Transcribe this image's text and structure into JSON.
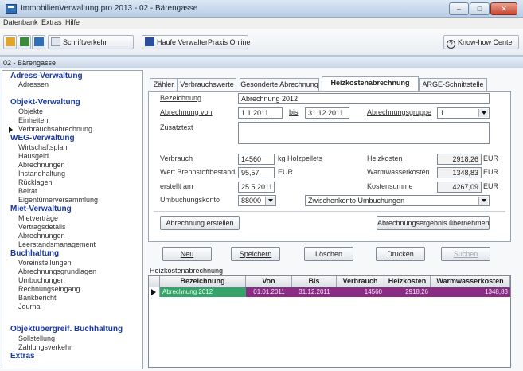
{
  "window": {
    "title": "ImmobilienVerwaltung pro 2013 - 02 - Bärengasse",
    "minimize": "–",
    "maximize": "□",
    "close": "✕"
  },
  "menu": [
    "Datenbank",
    "Extras",
    "Hilfe"
  ],
  "toolbar": {
    "schriftverkehr": "Schriftverkehr",
    "haufe": "Haufe VerwalterPraxis Online",
    "knowhow": "Know-how Center"
  },
  "document_title": "02 - Bärengasse",
  "sidebar": {
    "adress_head": "Adress-Verwaltung",
    "adress_items": [
      "Adressen"
    ],
    "objekt_head": "Objekt-Verwaltung",
    "objekt_items": [
      "Objekte",
      "Einheiten",
      "Verbrauchsabrechnung"
    ],
    "weg_head": "WEG-Verwaltung",
    "weg_items": [
      "Wirtschaftsplan",
      "Hausgeld",
      "Abrechnungen",
      "Instandhaltung",
      "Rücklagen",
      "Beirat",
      "Eigentümerversammlung"
    ],
    "miet_head": "Miet-Verwaltung",
    "miet_items": [
      "Mietverträge",
      "Vertragsdetails",
      "Abrechnungen",
      "Leerstandsmanagement"
    ],
    "buch_head": "Buchhaltung",
    "buch_items": [
      "Voreinstellungen",
      "Abrechnungsgrundlagen",
      "Umbuchungen",
      "Rechnungseingang",
      "Bankbericht",
      "Journal"
    ],
    "obj_buch_head": "Objektübergreif. Buchhaltung",
    "obj_buch_items": [
      "Sollstellung",
      "Zahlungsverkehr"
    ],
    "extras_head": "Extras"
  },
  "tabs": [
    "Zähler",
    "Verbrauchswerte",
    "Gesonderte Abrechnung",
    "Heizkostenabrechnung",
    "ARGE-Schnittstelle"
  ],
  "form": {
    "bezeichnung_label": "Bezeichnung",
    "bezeichnung_value": "Abrechnung 2012",
    "abrechnung_von_label": "Abrechnung von",
    "von_value": "1.1.2011",
    "bis_label": "bis",
    "bis_value": "31.12.2011",
    "gruppe_label": "Abrechnungsgruppe",
    "gruppe_value": "1",
    "zusatztext_label": "Zusatztext",
    "zusatztext_value": "",
    "verbrauch_label": "Verbrauch",
    "verbrauch_value": "14560",
    "verbrauch_unit": "kg Holzpellets",
    "brennstoff_label": "Wert Brennstoffbestand",
    "brennstoff_value": "95,57",
    "brennstoff_unit": "EUR",
    "erstellt_label": "erstellt am",
    "erstellt_value": "25.5.2011",
    "konto_label": "Umbuchungskonto",
    "konto_value": "88000",
    "konto_desc": "Zwischenkonto Umbuchungen",
    "heizkosten_label": "Heizkosten",
    "heizkosten_value": "2918,26",
    "heizkosten_unit": "EUR",
    "warmwasser_label": "Warmwasserkosten",
    "warmwasser_value": "1348,83",
    "warmwasser_unit": "EUR",
    "kostensumme_label": "Kostensumme",
    "kostensumme_value": "4267,09",
    "kostensumme_unit": "EUR",
    "btn_erstellen": "Abrechnung erstellen",
    "btn_uebernehmen": "Abrechnungsergebnis übernehmen"
  },
  "actions": {
    "neu": "Neu",
    "speichern": "Speichern",
    "loeschen": "Löschen",
    "drucken": "Drucken",
    "suchen": "Suchen"
  },
  "grid": {
    "label": "Heizkostenabrechnung",
    "columns": [
      "Bezeichnung",
      "Von",
      "Bis",
      "Verbrauch",
      "Heizkosten",
      "Warmwasserkosten"
    ],
    "rows": [
      [
        "Abrechnung 2012",
        "01.01.2011",
        "31.12.2011",
        "14560",
        "2918,26",
        "1348,83"
      ]
    ]
  },
  "colors": {
    "nav_head": "#1b3aa0",
    "row_highlight": "#8b2c84",
    "row_first_cell": "#36a36a"
  }
}
